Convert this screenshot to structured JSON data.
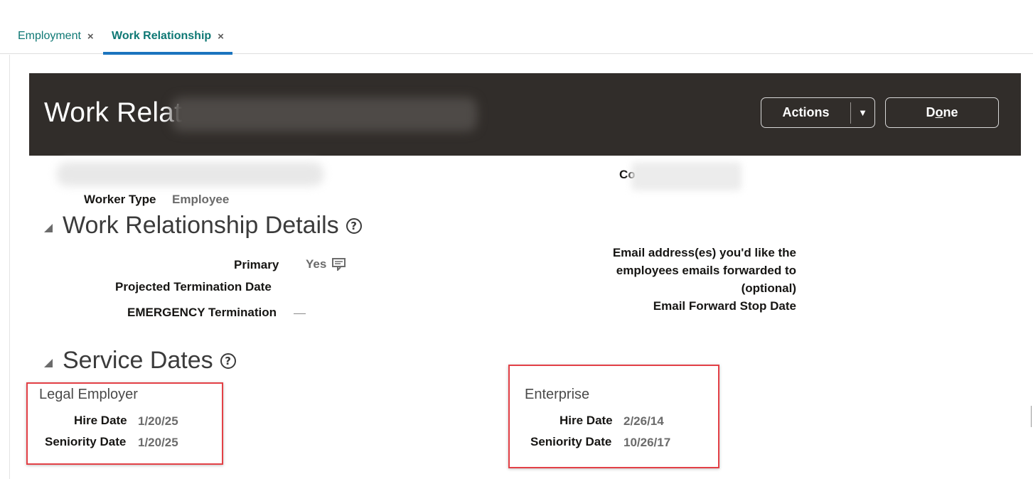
{
  "tabs": [
    {
      "label": "Employment",
      "close": "×"
    },
    {
      "label": "Work Relationship",
      "close": "×"
    }
  ],
  "header": {
    "title": "Work Relat",
    "actions_label": "Actions",
    "actions_caret": "▼",
    "done_label_pre": "D",
    "done_label_mnemonic": "o",
    "done_label_post": "ne"
  },
  "person": {
    "co_label": "Co",
    "worker_type_label": "Worker Type",
    "worker_type_value": "Employee"
  },
  "work_relationship_details": {
    "title": "Work Relationship Details",
    "help": "?",
    "primary_label": "Primary",
    "primary_value": "Yes",
    "projected_termination_label": "Projected Termination Date",
    "emergency_termination_label": "EMERGENCY Termination",
    "email_forward_line1": "Email address(es) you'd like the",
    "email_forward_line2": "employees emails forwarded to",
    "email_forward_line3": "(optional)",
    "email_forward_stop_label": "Email Forward Stop Date"
  },
  "service_dates": {
    "title": "Service Dates",
    "help": "?",
    "legal_employer": {
      "title": "Legal Employer",
      "hire_date_label": "Hire Date",
      "hire_date_value": "1/20/25",
      "seniority_date_label": "Seniority Date",
      "seniority_date_value": "1/20/25"
    },
    "enterprise": {
      "title": "Enterprise",
      "hire_date_label": "Hire Date",
      "hire_date_value": "2/26/14",
      "seniority_date_label": "Seniority Date",
      "seniority_date_value": "10/26/17"
    }
  },
  "colors": {
    "tab_active_text": "#0e7874",
    "tab_underline": "#1b74be",
    "header_bg": "#312d2a",
    "highlight_border": "#e34046"
  }
}
